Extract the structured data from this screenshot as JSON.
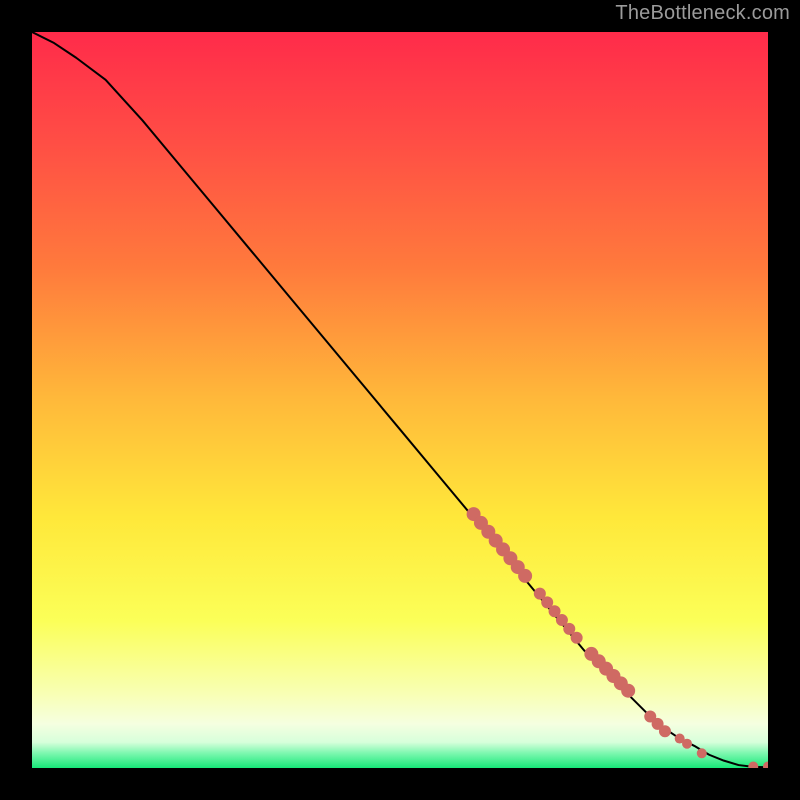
{
  "attribution": "TheBottleneck.com",
  "colors": {
    "gradient_top": "#ff2b4a",
    "gradient_mid_upper": "#ff6a3a",
    "gradient_mid": "#ffd23a",
    "gradient_lower": "#f9ff55",
    "gradient_pale": "#f8ffc5",
    "gradient_bottom": "#17e878",
    "curve": "#000000",
    "marker": "#cf6a63",
    "background": "#000000"
  },
  "chart_data": {
    "type": "line",
    "title": "",
    "xlabel": "",
    "ylabel": "",
    "xlim": [
      0,
      100
    ],
    "ylim": [
      0,
      100
    ],
    "curve": {
      "x": [
        0,
        3,
        6,
        10,
        15,
        20,
        25,
        30,
        35,
        40,
        45,
        50,
        55,
        60,
        65,
        70,
        75,
        80,
        85,
        88,
        90,
        92,
        94,
        96,
        98,
        100
      ],
      "y": [
        100,
        98.5,
        96.5,
        93.5,
        88,
        82,
        76,
        70,
        64,
        58,
        52,
        46,
        40,
        34,
        28,
        22,
        16,
        11,
        6,
        4,
        3,
        1.8,
        1.0,
        0.4,
        0.15,
        0.1
      ]
    },
    "markers": {
      "x": [
        60,
        61,
        62,
        63,
        64,
        65,
        66,
        67,
        69,
        70,
        71,
        72,
        73,
        74,
        76,
        77,
        78,
        79,
        80,
        81,
        84,
        85,
        86,
        88,
        89,
        91,
        98,
        100
      ],
      "y": [
        34.5,
        33.3,
        32.1,
        30.9,
        29.7,
        28.5,
        27.3,
        26.1,
        23.7,
        22.5,
        21.3,
        20.1,
        18.9,
        17.7,
        15.5,
        14.5,
        13.5,
        12.5,
        11.5,
        10.5,
        7.0,
        6.0,
        5.0,
        4.0,
        3.3,
        2.0,
        0.2,
        0.2
      ],
      "sizes": [
        7,
        7,
        7,
        7,
        7,
        7,
        7,
        7,
        6,
        6,
        6,
        6,
        6,
        6,
        7,
        7,
        7,
        7,
        7,
        7,
        6,
        6,
        6,
        5,
        5,
        5,
        5,
        5
      ]
    }
  }
}
